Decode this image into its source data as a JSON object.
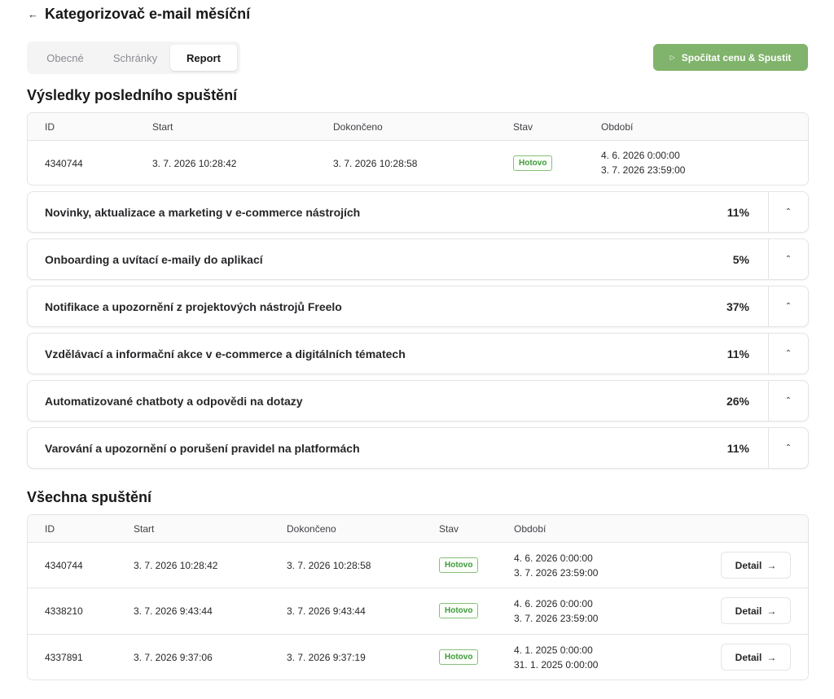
{
  "header": {
    "back_icon": "arrow-left-icon",
    "title": "Kategorizovač e-mail měsíční"
  },
  "tabs": [
    {
      "label": "Obecné",
      "active": false
    },
    {
      "label": "Schránky",
      "active": false
    },
    {
      "label": "Report",
      "active": true
    }
  ],
  "run_button": {
    "icon": "play-icon",
    "label": "Spočítat cenu & Spustit",
    "color": "#80b36b"
  },
  "last_run": {
    "title": "Výsledky posledního spuštění",
    "columns": [
      "ID",
      "Start",
      "Dokončeno",
      "Stav",
      "Období"
    ],
    "row": {
      "id": "4340744",
      "start": "3. 7. 2026 10:28:42",
      "finished": "3. 7. 2026 10:28:58",
      "status": "Hotovo",
      "period_from": "4. 6. 2026 0:00:00",
      "period_to": "3. 7. 2026 23:59:00"
    }
  },
  "categories": [
    {
      "label": "Novinky, aktualizace a marketing v e-commerce nástrojích",
      "percent": "11%"
    },
    {
      "label": "Onboarding a uvítací e-maily do aplikací",
      "percent": "5%"
    },
    {
      "label": "Notifikace a upozornění z projektových nástrojů Freelo",
      "percent": "37%"
    },
    {
      "label": "Vzdělávací a informační akce v e-commerce a digitálních tématech",
      "percent": "11%"
    },
    {
      "label": "Automatizované chatboty a odpovědi na dotazy",
      "percent": "26%"
    },
    {
      "label": "Varování a upozornění o porušení pravidel na platformách",
      "percent": "11%"
    }
  ],
  "all_runs": {
    "title": "Všechna spuštění",
    "columns": [
      "ID",
      "Start",
      "Dokončeno",
      "Stav",
      "Období"
    ],
    "detail_label": "Detail",
    "rows": [
      {
        "id": "4340744",
        "start": "3. 7. 2026 10:28:42",
        "finished": "3. 7. 2026 10:28:58",
        "status": "Hotovo",
        "period_from": "4. 6. 2026 0:00:00",
        "period_to": "3. 7. 2026 23:59:00"
      },
      {
        "id": "4338210",
        "start": "3. 7. 2026 9:43:44",
        "finished": "3. 7. 2026 9:43:44",
        "status": "Hotovo",
        "period_from": "4. 6. 2026 0:00:00",
        "period_to": "3. 7. 2026 23:59:00"
      },
      {
        "id": "4337891",
        "start": "3. 7. 2026 9:37:06",
        "finished": "3. 7. 2026 9:37:19",
        "status": "Hotovo",
        "period_from": "4. 1. 2025 0:00:00",
        "period_to": "31. 1. 2025 0:00:00"
      }
    ]
  },
  "colors": {
    "accent_green": "#80b36b",
    "badge_green": "#3f9a3c",
    "border": "#e4e4e7"
  }
}
